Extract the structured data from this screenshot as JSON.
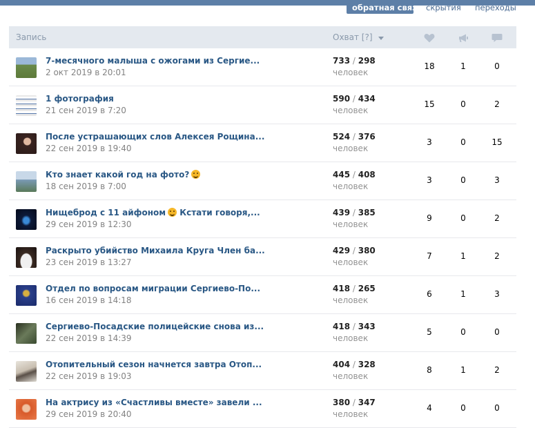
{
  "tabs": [
    {
      "label": "обратная связь",
      "active": true
    },
    {
      "label": "скрытия",
      "active": false
    },
    {
      "label": "переходы",
      "active": false
    }
  ],
  "table": {
    "headers": {
      "post": "Запись",
      "reach": "Охват [?]"
    },
    "header_icons": [
      "heart-icon",
      "megaphone-icon",
      "comment-icon"
    ],
    "rows": [
      {
        "title": "7-месячного малыша с ожогами из Сергие...",
        "date": "2 окт 2019 в 20:01",
        "reach_total": "733",
        "reach_sub": "298",
        "unit": "человек",
        "likes": "18",
        "shares": "1",
        "comments": "0",
        "thumb_color": "#6a8a4a"
      },
      {
        "title": "1 фотография",
        "date": "21 сен 2019 в 7:20",
        "reach_total": "590",
        "reach_sub": "434",
        "unit": "человек",
        "likes": "15",
        "shares": "0",
        "comments": "2",
        "thumb_color": "#c9c9c9"
      },
      {
        "title": "После устрашающих слов Алексея Рощина...",
        "date": "22 сен 2019 в 19:40",
        "reach_total": "524",
        "reach_sub": "376",
        "unit": "человек",
        "likes": "3",
        "shares": "0",
        "comments": "15",
        "thumb_color": "#4a2f2a"
      },
      {
        "title": "Кто знает какой год на фото?",
        "emoji": true,
        "date": "18 сен 2019 в 7:00",
        "reach_total": "445",
        "reach_sub": "408",
        "unit": "человек",
        "likes": "3",
        "shares": "0",
        "comments": "3",
        "thumb_color": "#7a9ab5"
      },
      {
        "title": "Нищеброд с 11 айфоном",
        "emoji": true,
        "title_tail": "Кстати говоря,...",
        "date": "29 сен 2019 в 12:30",
        "reach_total": "439",
        "reach_sub": "385",
        "unit": "человек",
        "likes": "9",
        "shares": "0",
        "comments": "2",
        "thumb_color": "#0d1a3a"
      },
      {
        "title": "Раскрыто убийство Михаила Круга Член ба...",
        "date": "23 сен 2019 в 13:27",
        "reach_total": "429",
        "reach_sub": "380",
        "unit": "человек",
        "likes": "7",
        "shares": "1",
        "comments": "2",
        "thumb_color": "#3a2a22"
      },
      {
        "title": "Отдел по вопросам миграции Сергиево-По...",
        "date": "16 сен 2019 в 14:18",
        "reach_total": "418",
        "reach_sub": "265",
        "unit": "человек",
        "likes": "6",
        "shares": "1",
        "comments": "3",
        "thumb_color": "#2a3f8a"
      },
      {
        "title": "Сергиево-Посадские полицейские снова из...",
        "date": "22 сен 2019 в 14:39",
        "reach_total": "418",
        "reach_sub": "343",
        "unit": "человек",
        "likes": "5",
        "shares": "0",
        "comments": "0",
        "thumb_color": "#4a5a3a"
      },
      {
        "title": "Отопительный сезон начнется завтра Отоп...",
        "date": "22 сен 2019 в 19:03",
        "reach_total": "404",
        "reach_sub": "328",
        "unit": "человек",
        "likes": "8",
        "shares": "1",
        "comments": "2",
        "thumb_color": "#a89a88"
      },
      {
        "title": "На актрису из «Счастливы вместе» завели ...",
        "date": "29 сен 2019 в 20:40",
        "reach_total": "380",
        "reach_sub": "347",
        "unit": "человек",
        "likes": "4",
        "shares": "0",
        "comments": "0",
        "thumb_color": "#d85a2a"
      }
    ]
  },
  "colors": {
    "accent": "#5d7fa7",
    "link": "#2a5885",
    "header_bg": "#e4e9ef",
    "muted": "#828282"
  }
}
